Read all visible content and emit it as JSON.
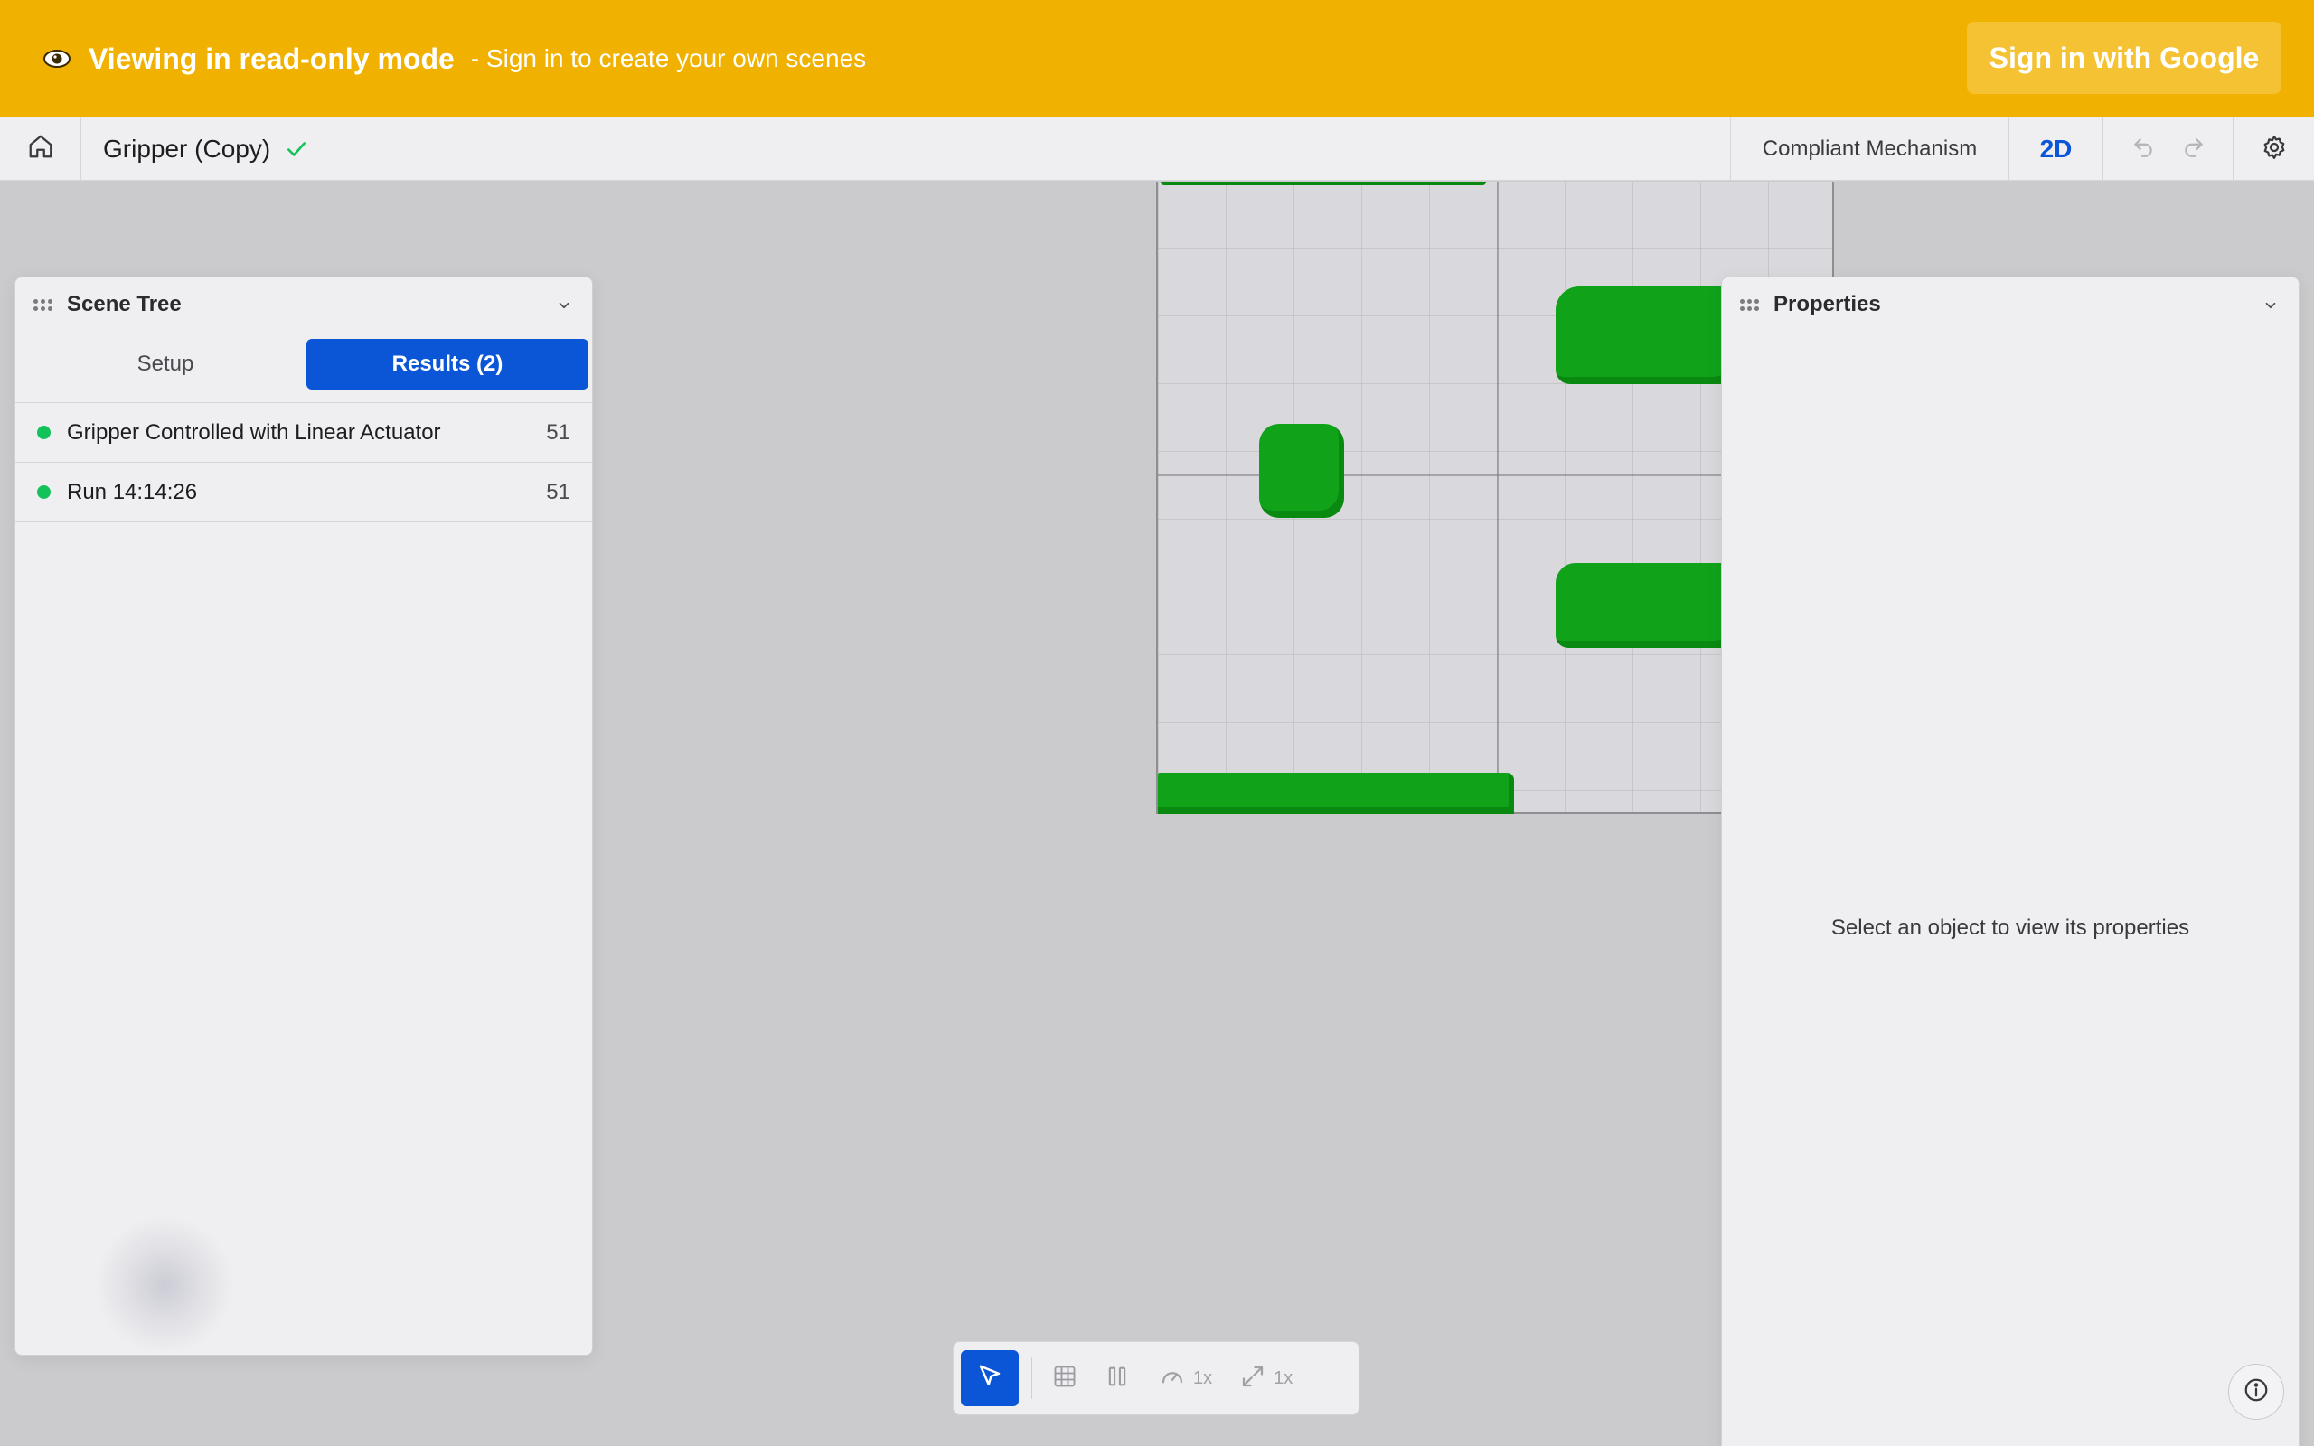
{
  "banner": {
    "icon": "eye-icon",
    "title": "Viewing in read-only mode",
    "subtitle": "- Sign in to create your own scenes",
    "signin_label": "Sign in with Google",
    "background": "#f0b100"
  },
  "header": {
    "title": "Gripper (Copy)",
    "saved_icon": "check-icon",
    "mode": "Compliant Mechanism",
    "view_mode": "2D",
    "accent": "#0a56d6"
  },
  "scene_tree": {
    "title": "Scene Tree",
    "tabs": {
      "setup": "Setup",
      "results": "Results (2)"
    },
    "items": [
      {
        "label": "Gripper Controlled with Linear Actuator",
        "count": "51",
        "status_color": "#14c25a"
      },
      {
        "label": "Run 14:14:26",
        "count": "51",
        "status_color": "#14c25a"
      }
    ]
  },
  "properties": {
    "title": "Properties",
    "empty_message": "Select an object to view its properties"
  },
  "toolbar": {
    "speed_label": "1x",
    "zoom_label": "1x"
  },
  "colors": {
    "mesh": "#10a31a",
    "canvas": "#cbcbcd"
  }
}
